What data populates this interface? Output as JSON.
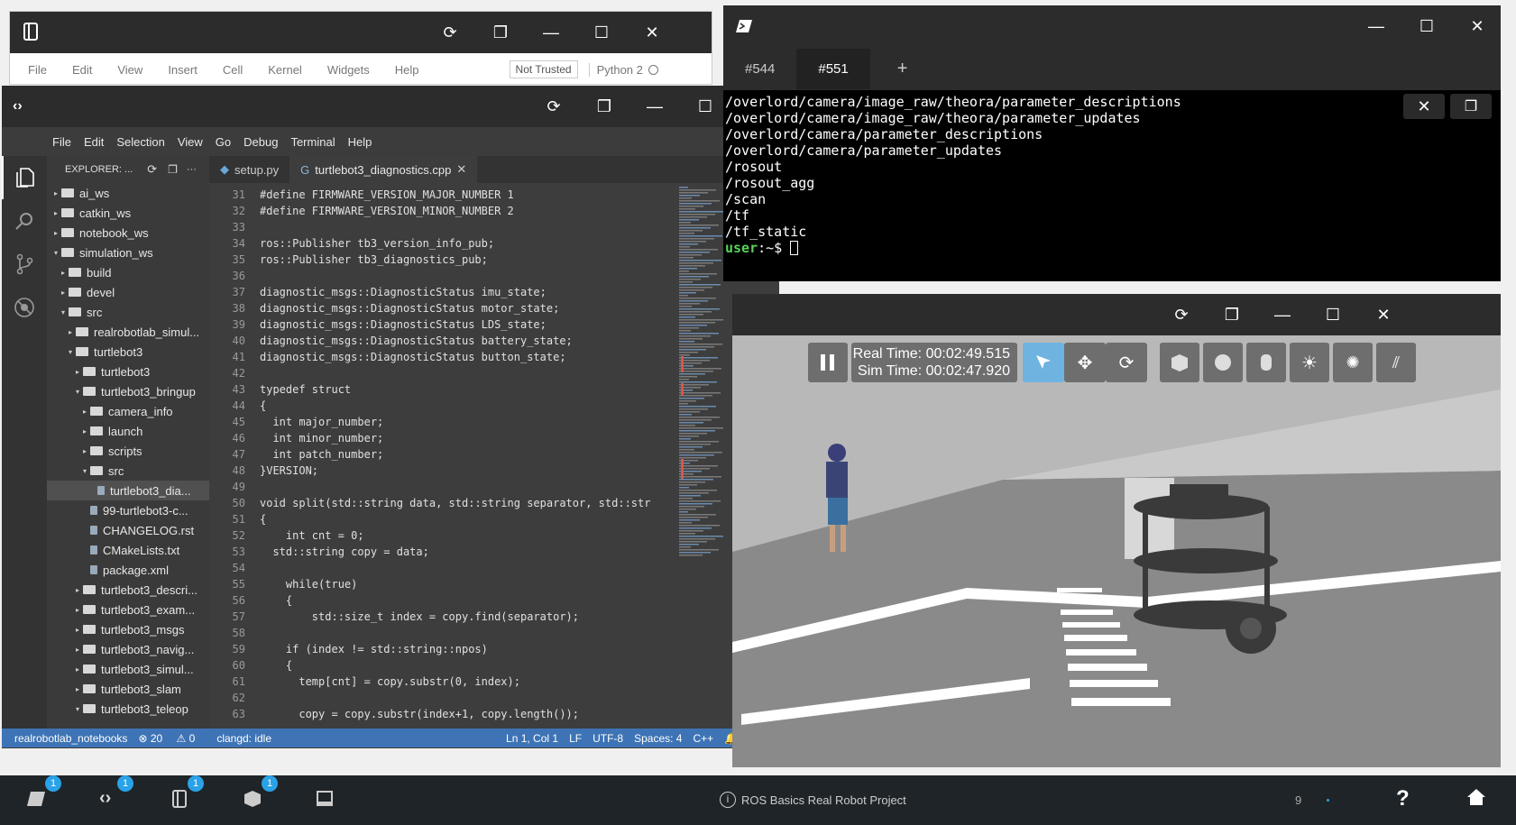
{
  "jupyter": {
    "menu": [
      "File",
      "Edit",
      "View",
      "Insert",
      "Cell",
      "Kernel",
      "Widgets",
      "Help"
    ],
    "trust": "Not Trusted",
    "kernel": "Python 2"
  },
  "vscode": {
    "menu": [
      "File",
      "Edit",
      "Selection",
      "View",
      "Go",
      "Debug",
      "Terminal",
      "Help"
    ],
    "explorer_label": "EXPLORER: ...",
    "tree": [
      {
        "label": "ai_ws",
        "indent": 0,
        "kind": "folder",
        "arrow": "▸"
      },
      {
        "label": "catkin_ws",
        "indent": 0,
        "kind": "folder",
        "arrow": "▸"
      },
      {
        "label": "notebook_ws",
        "indent": 0,
        "kind": "folder",
        "arrow": "▸"
      },
      {
        "label": "simulation_ws",
        "indent": 0,
        "kind": "folder",
        "arrow": "▾"
      },
      {
        "label": "build",
        "indent": 1,
        "kind": "folder",
        "arrow": "▸"
      },
      {
        "label": "devel",
        "indent": 1,
        "kind": "folder",
        "arrow": "▸"
      },
      {
        "label": "src",
        "indent": 1,
        "kind": "folder",
        "arrow": "▾"
      },
      {
        "label": "realrobotlab_simul...",
        "indent": 2,
        "kind": "folder",
        "arrow": "▸"
      },
      {
        "label": "turtlebot3",
        "indent": 2,
        "kind": "folder",
        "arrow": "▾"
      },
      {
        "label": "turtlebot3",
        "indent": 3,
        "kind": "folder",
        "arrow": "▸"
      },
      {
        "label": "turtlebot3_bringup",
        "indent": 3,
        "kind": "folder",
        "arrow": "▾"
      },
      {
        "label": "camera_info",
        "indent": 4,
        "kind": "folder",
        "arrow": "▸"
      },
      {
        "label": "launch",
        "indent": 4,
        "kind": "folder",
        "arrow": "▸"
      },
      {
        "label": "scripts",
        "indent": 4,
        "kind": "folder",
        "arrow": "▸"
      },
      {
        "label": "src",
        "indent": 4,
        "kind": "folder",
        "arrow": "▾"
      },
      {
        "label": "turtlebot3_dia...",
        "indent": 5,
        "kind": "file",
        "arrow": ""
      },
      {
        "label": "99-turtlebot3-c...",
        "indent": 4,
        "kind": "file",
        "arrow": ""
      },
      {
        "label": "CHANGELOG.rst",
        "indent": 4,
        "kind": "file",
        "arrow": ""
      },
      {
        "label": "CMakeLists.txt",
        "indent": 4,
        "kind": "file",
        "arrow": ""
      },
      {
        "label": "package.xml",
        "indent": 4,
        "kind": "file",
        "arrow": ""
      },
      {
        "label": "turtlebot3_descri...",
        "indent": 3,
        "kind": "folder",
        "arrow": "▸"
      },
      {
        "label": "turtlebot3_exam...",
        "indent": 3,
        "kind": "folder",
        "arrow": "▸"
      },
      {
        "label": "turtlebot3_msgs",
        "indent": 3,
        "kind": "folder",
        "arrow": "▸"
      },
      {
        "label": "turtlebot3_navig...",
        "indent": 3,
        "kind": "folder",
        "arrow": "▸"
      },
      {
        "label": "turtlebot3_simul...",
        "indent": 3,
        "kind": "folder",
        "arrow": "▸"
      },
      {
        "label": "turtlebot3_slam",
        "indent": 3,
        "kind": "folder",
        "arrow": "▸"
      },
      {
        "label": "turtlebot3_teleop",
        "indent": 3,
        "kind": "folder",
        "arrow": "▾"
      }
    ],
    "tabs": [
      "setup.py",
      "turtlebot3_diagnostics.cpp"
    ],
    "code": [
      {
        "n": "31",
        "t": "#define FIRMWARE_VERSION_MAJOR_NUMBER 1"
      },
      {
        "n": "32",
        "t": "#define FIRMWARE_VERSION_MINOR_NUMBER 2"
      },
      {
        "n": "33",
        "t": ""
      },
      {
        "n": "34",
        "t": "ros::Publisher tb3_version_info_pub;"
      },
      {
        "n": "35",
        "t": "ros::Publisher tb3_diagnostics_pub;"
      },
      {
        "n": "36",
        "t": ""
      },
      {
        "n": "37",
        "t": "diagnostic_msgs::DiagnosticStatus imu_state;"
      },
      {
        "n": "38",
        "t": "diagnostic_msgs::DiagnosticStatus motor_state;"
      },
      {
        "n": "39",
        "t": "diagnostic_msgs::DiagnosticStatus LDS_state;"
      },
      {
        "n": "40",
        "t": "diagnostic_msgs::DiagnosticStatus battery_state;"
      },
      {
        "n": "41",
        "t": "diagnostic_msgs::DiagnosticStatus button_state;"
      },
      {
        "n": "42",
        "t": ""
      },
      {
        "n": "43",
        "t": "typedef struct"
      },
      {
        "n": "44",
        "t": "{"
      },
      {
        "n": "45",
        "t": "  int major_number;"
      },
      {
        "n": "46",
        "t": "  int minor_number;"
      },
      {
        "n": "47",
        "t": "  int patch_number;"
      },
      {
        "n": "48",
        "t": "}VERSION;"
      },
      {
        "n": "49",
        "t": ""
      },
      {
        "n": "50",
        "t": "void split(std::string data, std::string separator, std::str"
      },
      {
        "n": "51",
        "t": "{"
      },
      {
        "n": "52",
        "t": "    int cnt = 0;"
      },
      {
        "n": "53",
        "t": "  std::string copy = data;"
      },
      {
        "n": "54",
        "t": ""
      },
      {
        "n": "55",
        "t": "    while(true)"
      },
      {
        "n": "56",
        "t": "    {"
      },
      {
        "n": "57",
        "t": "        std::size_t index = copy.find(separator);"
      },
      {
        "n": "58",
        "t": ""
      },
      {
        "n": "59",
        "t": "    if (index != std::string::npos)"
      },
      {
        "n": "60",
        "t": "    {"
      },
      {
        "n": "61",
        "t": "      temp[cnt] = copy.substr(0, index);"
      },
      {
        "n": "62",
        "t": ""
      },
      {
        "n": "63",
        "t": "      copy = copy.substr(index+1, copy.length());"
      }
    ],
    "status": {
      "repo": "realrobotlab_notebooks",
      "errors": "20",
      "warnings": "0",
      "clangd": "clangd: idle",
      "position": "Ln 1, Col 1",
      "eol": "LF",
      "encoding": "UTF-8",
      "spaces": "Spaces: 4",
      "lang": "C++"
    }
  },
  "terminal": {
    "tabs": [
      "#544",
      "#551"
    ],
    "lines": [
      "/overlord/camera/image_raw/theora/parameter_descriptions",
      "/overlord/camera/image_raw/theora/parameter_updates",
      "/overlord/camera/parameter_descriptions",
      "/overlord/camera/parameter_updates",
      "/rosout",
      "/rosout_agg",
      "/scan",
      "/tf",
      "/tf_static"
    ],
    "prompt_user": "user",
    "prompt_rest": ":~$ "
  },
  "gazebo": {
    "real_time": "Real Time: 00:02:49.515",
    "sim_time": "Sim Time: 00:02:47.920"
  },
  "taskbar": {
    "badges": [
      "1",
      "1",
      "1",
      "1"
    ],
    "project": "ROS Basics Real Robot Project",
    "count": "9"
  }
}
